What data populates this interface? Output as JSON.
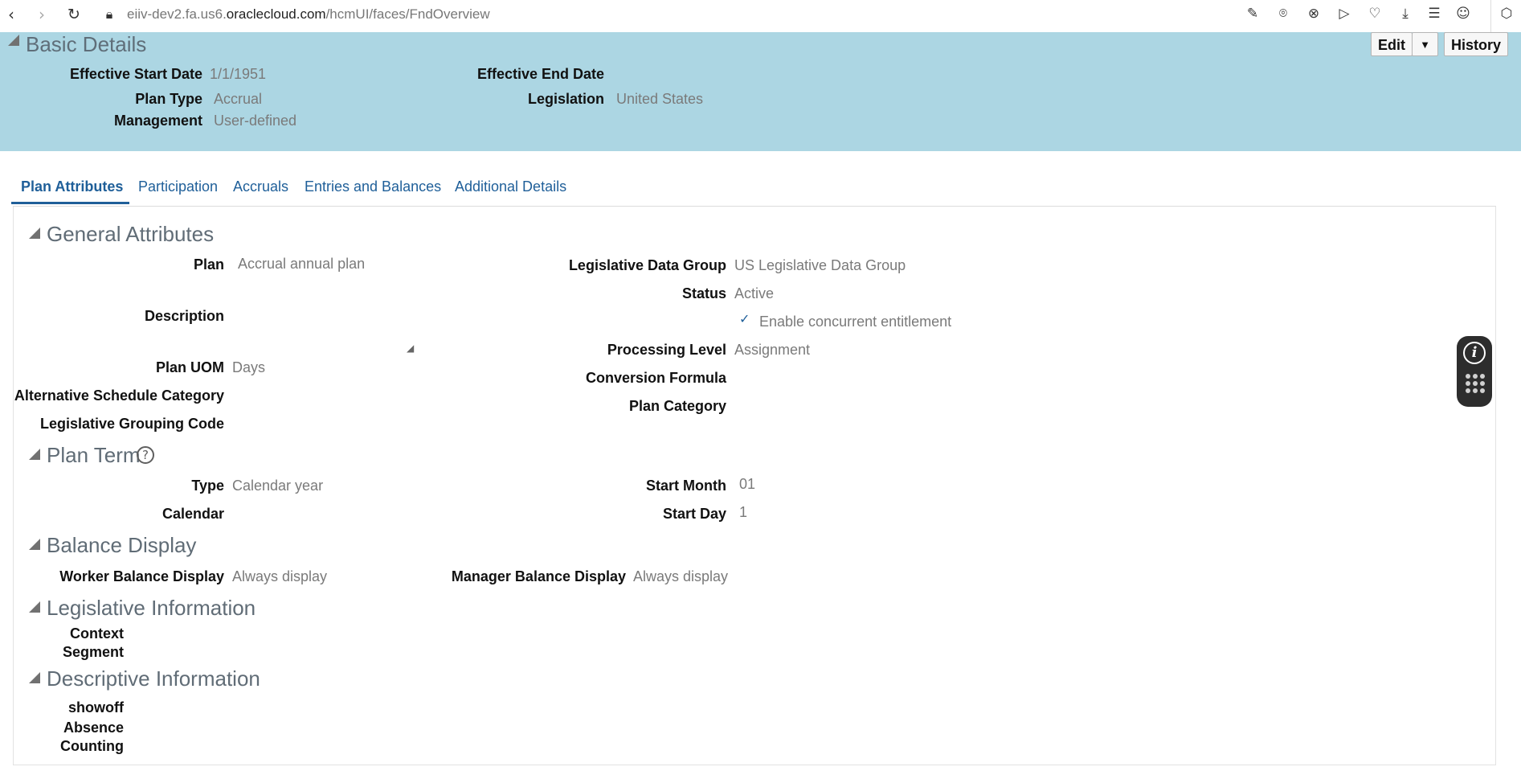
{
  "browser": {
    "url_prefix": "eiiv-dev2.fa.us6.",
    "url_domain": "oraclecloud.com",
    "url_path": "/hcmUI/faces/FndOverview",
    "icons": [
      "back-icon",
      "forward-icon",
      "reload-icon",
      "lock-icon",
      "edit-icon",
      "camera-icon",
      "close-circle-icon",
      "play-icon",
      "heart-icon",
      "download-icon",
      "menu-icon",
      "profile-icon",
      "cube-icon"
    ]
  },
  "header": {
    "section_title": "Basic Details",
    "edit_label": "Edit",
    "history_label": "History",
    "fields": {
      "effective_start_date_label": "Effective Start Date",
      "effective_start_date_value": "1/1/1951",
      "effective_end_date_label": "Effective End Date",
      "plan_type_label": "Plan Type",
      "plan_type_value": "Accrual",
      "legislation_label": "Legislation",
      "legislation_value": "United States",
      "management_label": "Management",
      "management_value": "User-defined"
    }
  },
  "tabs": [
    {
      "label": "Plan Attributes",
      "active": true
    },
    {
      "label": "Participation"
    },
    {
      "label": "Accruals"
    },
    {
      "label": "Entries and Balances"
    },
    {
      "label": "Additional Details"
    }
  ],
  "general": {
    "title": "General Attributes",
    "plan_label": "Plan",
    "plan_value": "Accrual annual plan",
    "description_label": "Description",
    "plan_uom_label": "Plan UOM",
    "plan_uom_value": "Days",
    "alt_schedule_label": "Alternative Schedule Category",
    "legislative_grouping_label": "Legislative Grouping Code",
    "ldg_label": "Legislative Data Group",
    "ldg_value": "US Legislative Data Group",
    "status_label": "Status",
    "status_value": "Active",
    "concurrent_label": "Enable concurrent entitlement",
    "processing_level_label": "Processing Level",
    "processing_level_value": "Assignment",
    "conversion_formula_label": "Conversion Formula",
    "plan_category_label": "Plan Category"
  },
  "plan_term": {
    "title": "Plan Term",
    "type_label": "Type",
    "type_value": "Calendar year",
    "calendar_label": "Calendar",
    "start_month_label": "Start Month",
    "start_month_value": "01",
    "start_day_label": "Start Day",
    "start_day_value": "1"
  },
  "balance_display": {
    "title": "Balance Display",
    "worker_label": "Worker Balance Display",
    "worker_value": "Always display",
    "manager_label": "Manager Balance Display",
    "manager_value": "Always display"
  },
  "legislative_info": {
    "title": "Legislative Information",
    "context_label": "Context",
    "segment_label": "Segment"
  },
  "descriptive_info": {
    "title": "Descriptive Information",
    "line1": "showoff",
    "line2": "Absence",
    "line3": "Counting"
  }
}
